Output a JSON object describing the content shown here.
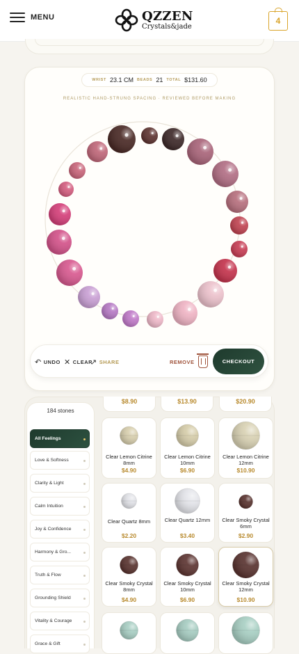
{
  "header": {
    "menu_label": "MENU",
    "logo_name": "QZZEN",
    "logo_sub": "Crystals&jade",
    "cart_count": "4",
    "accent": "#d9a42a"
  },
  "builder": {
    "wrist_label": "WRIST",
    "wrist_value": "23.1 CM",
    "beads_label": "BEADS",
    "beads_value": "21",
    "total_label": "TOTAL",
    "total_value": "$131.60",
    "note": "REALISTIC HAND-STRUNG SPACING · REVIEWED BEFORE MAKING",
    "bead_colors": [
      "#4a2a26",
      "#5e3431",
      "#c0687a",
      "#c9667b",
      "#d45e80",
      "#d4407a",
      "#d3538a",
      "#d85a90",
      "#c9a0d4",
      "#b67ac4",
      "#c07ac8",
      "#eeb8c8",
      "#efb4c4",
      "#ecc2cc",
      "#c4344d",
      "#c73e55",
      "#c04452",
      "#b7707e",
      "#b26f85",
      "#a9657a",
      "#3e2a2a"
    ],
    "toolbar": {
      "undo": "UNDO",
      "clear": "CLEAR",
      "share": "SHARE",
      "remove": "REMOVE",
      "checkout": "CHECKOUT"
    }
  },
  "sidebar": {
    "count": "184 stones",
    "filters": [
      {
        "label": "All Feelings",
        "active": true
      },
      {
        "label": "Love & Softness",
        "active": false
      },
      {
        "label": "Clarity & Light",
        "active": false
      },
      {
        "label": "Calm Intuition",
        "active": false
      },
      {
        "label": "Joy & Confidence",
        "active": false
      },
      {
        "label": "Harmony & Gro...",
        "active": false
      },
      {
        "label": "Truth & Flow",
        "active": false
      },
      {
        "label": "Grounding Shield",
        "active": false
      },
      {
        "label": "Vitality & Courage",
        "active": false
      },
      {
        "label": "Grace & Gift",
        "active": false
      }
    ]
  },
  "products": {
    "top_prices": [
      "$8.90",
      "$13.90",
      "$20.90"
    ],
    "rows": [
      [
        {
          "name": "Clear Lemon Citrine 8mm",
          "price": "$4.90",
          "color": "#d8cfae"
        },
        {
          "name": "Clear Lemon Citrine 10mm",
          "price": "$6.90",
          "color": "#d6cdaa"
        },
        {
          "name": "Clear Lemon Citrine 12mm",
          "price": "$10.90",
          "color": "#d9d2b4"
        }
      ],
      [
        {
          "name": "Clear Quartz 8mm",
          "price": "$2.20",
          "color": "#e2e3e8"
        },
        {
          "name": "Clear Quartz 12mm",
          "price": "$3.40",
          "color": "#e4e5ea"
        },
        {
          "name": "Clear Smoky Crystal 6mm",
          "price": "$2.90",
          "color": "#5a3430"
        }
      ],
      [
        {
          "name": "Clear Smoky Crystal 8mm",
          "price": "$4.90",
          "color": "#5a3430"
        },
        {
          "name": "Clear Smoky Crystal 10mm",
          "price": "$6.90",
          "color": "#5e3633"
        },
        {
          "name": "Clear Smoky Crystal 12mm",
          "price": "$10.90",
          "color": "#5a3431"
        }
      ],
      [
        {
          "name": "",
          "price": "",
          "color": "#a9cfc4"
        },
        {
          "name": "",
          "price": "",
          "color": "#a7cdc2"
        },
        {
          "name": "",
          "price": "",
          "color": "#a9d0c4"
        }
      ]
    ]
  }
}
